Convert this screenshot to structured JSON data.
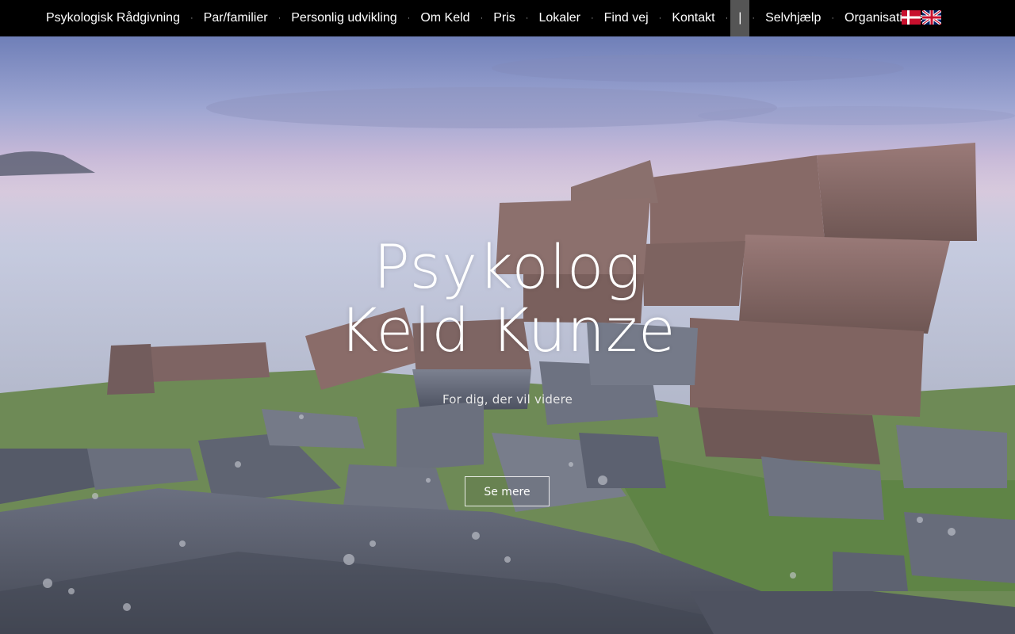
{
  "nav": {
    "items": [
      {
        "label": "Psykologisk Rådgivning"
      },
      {
        "label": "Par/familier"
      },
      {
        "label": "Personlig udvikling"
      },
      {
        "label": "Om Keld"
      },
      {
        "label": "Pris"
      },
      {
        "label": "Lokaler"
      },
      {
        "label": "Find vej"
      },
      {
        "label": "Kontakt"
      },
      {
        "label": "|"
      },
      {
        "label": "Selvhjælp"
      },
      {
        "label": "Organisationer"
      }
    ],
    "separator": "·",
    "flags": [
      {
        "icon": "danish-flag-icon",
        "language": "da"
      },
      {
        "icon": "english-flag-icon",
        "language": "en"
      }
    ]
  },
  "hero": {
    "title_line1": "Psykolog",
    "title_line2": "Keld Kunze",
    "subtitle": "For dig, der vil videre",
    "button_label": "Se mere"
  },
  "colors": {
    "nav_background": "#000000",
    "nav_active_background": "#555555",
    "text": "#ffffff"
  }
}
